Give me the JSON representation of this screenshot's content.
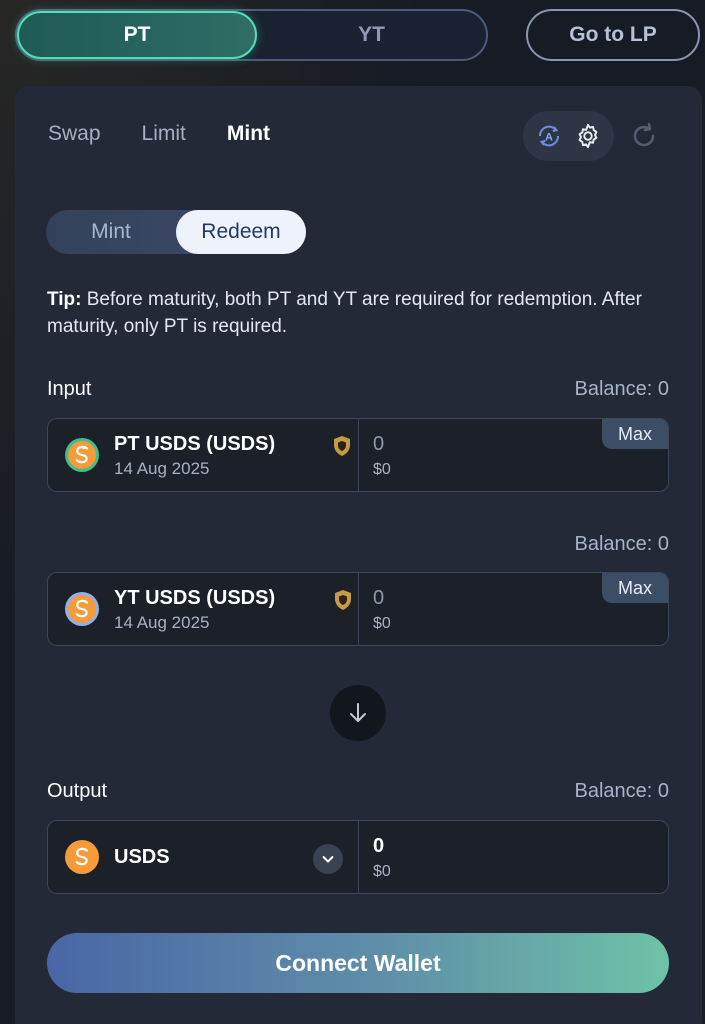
{
  "top_toggle": {
    "pt_label": "PT",
    "yt_label": "YT",
    "selected": "PT"
  },
  "go_lp_label": "Go to LP",
  "tabs": [
    {
      "label": "Swap",
      "active": false
    },
    {
      "label": "Limit",
      "active": false
    },
    {
      "label": "Mint",
      "active": true
    }
  ],
  "icons": {
    "auto": "auto-mode-icon",
    "settings": "gear-icon",
    "refresh": "refresh-icon"
  },
  "mode_toggle": {
    "mint_label": "Mint",
    "redeem_label": "Redeem",
    "selected": "Redeem"
  },
  "tip": {
    "prefix": "Tip:",
    "text": " Before maturity, both PT and YT are required for redemption. After maturity, only PT is required."
  },
  "input": {
    "label": "Input",
    "balance": "Balance: 0",
    "pt_token": {
      "name": "PT USDS (USDS)",
      "date": "14 Aug 2025",
      "amount": "0",
      "usd": "$0",
      "max_label": "Max"
    },
    "yt_balance": "Balance: 0",
    "yt_token": {
      "name": "YT USDS (USDS)",
      "date": "14 Aug 2025",
      "amount": "0",
      "usd": "$0",
      "max_label": "Max"
    }
  },
  "output": {
    "label": "Output",
    "balance": "Balance: 0",
    "token": {
      "name": "USDS",
      "amount": "0",
      "usd": "$0"
    }
  },
  "connect_label": "Connect Wallet",
  "colors": {
    "accent_green": "#4fe0b4",
    "panel_bg": "#232936",
    "page_bg": "#161b24",
    "shield": "#c79a45",
    "usds_orange": "#f79a3a"
  }
}
